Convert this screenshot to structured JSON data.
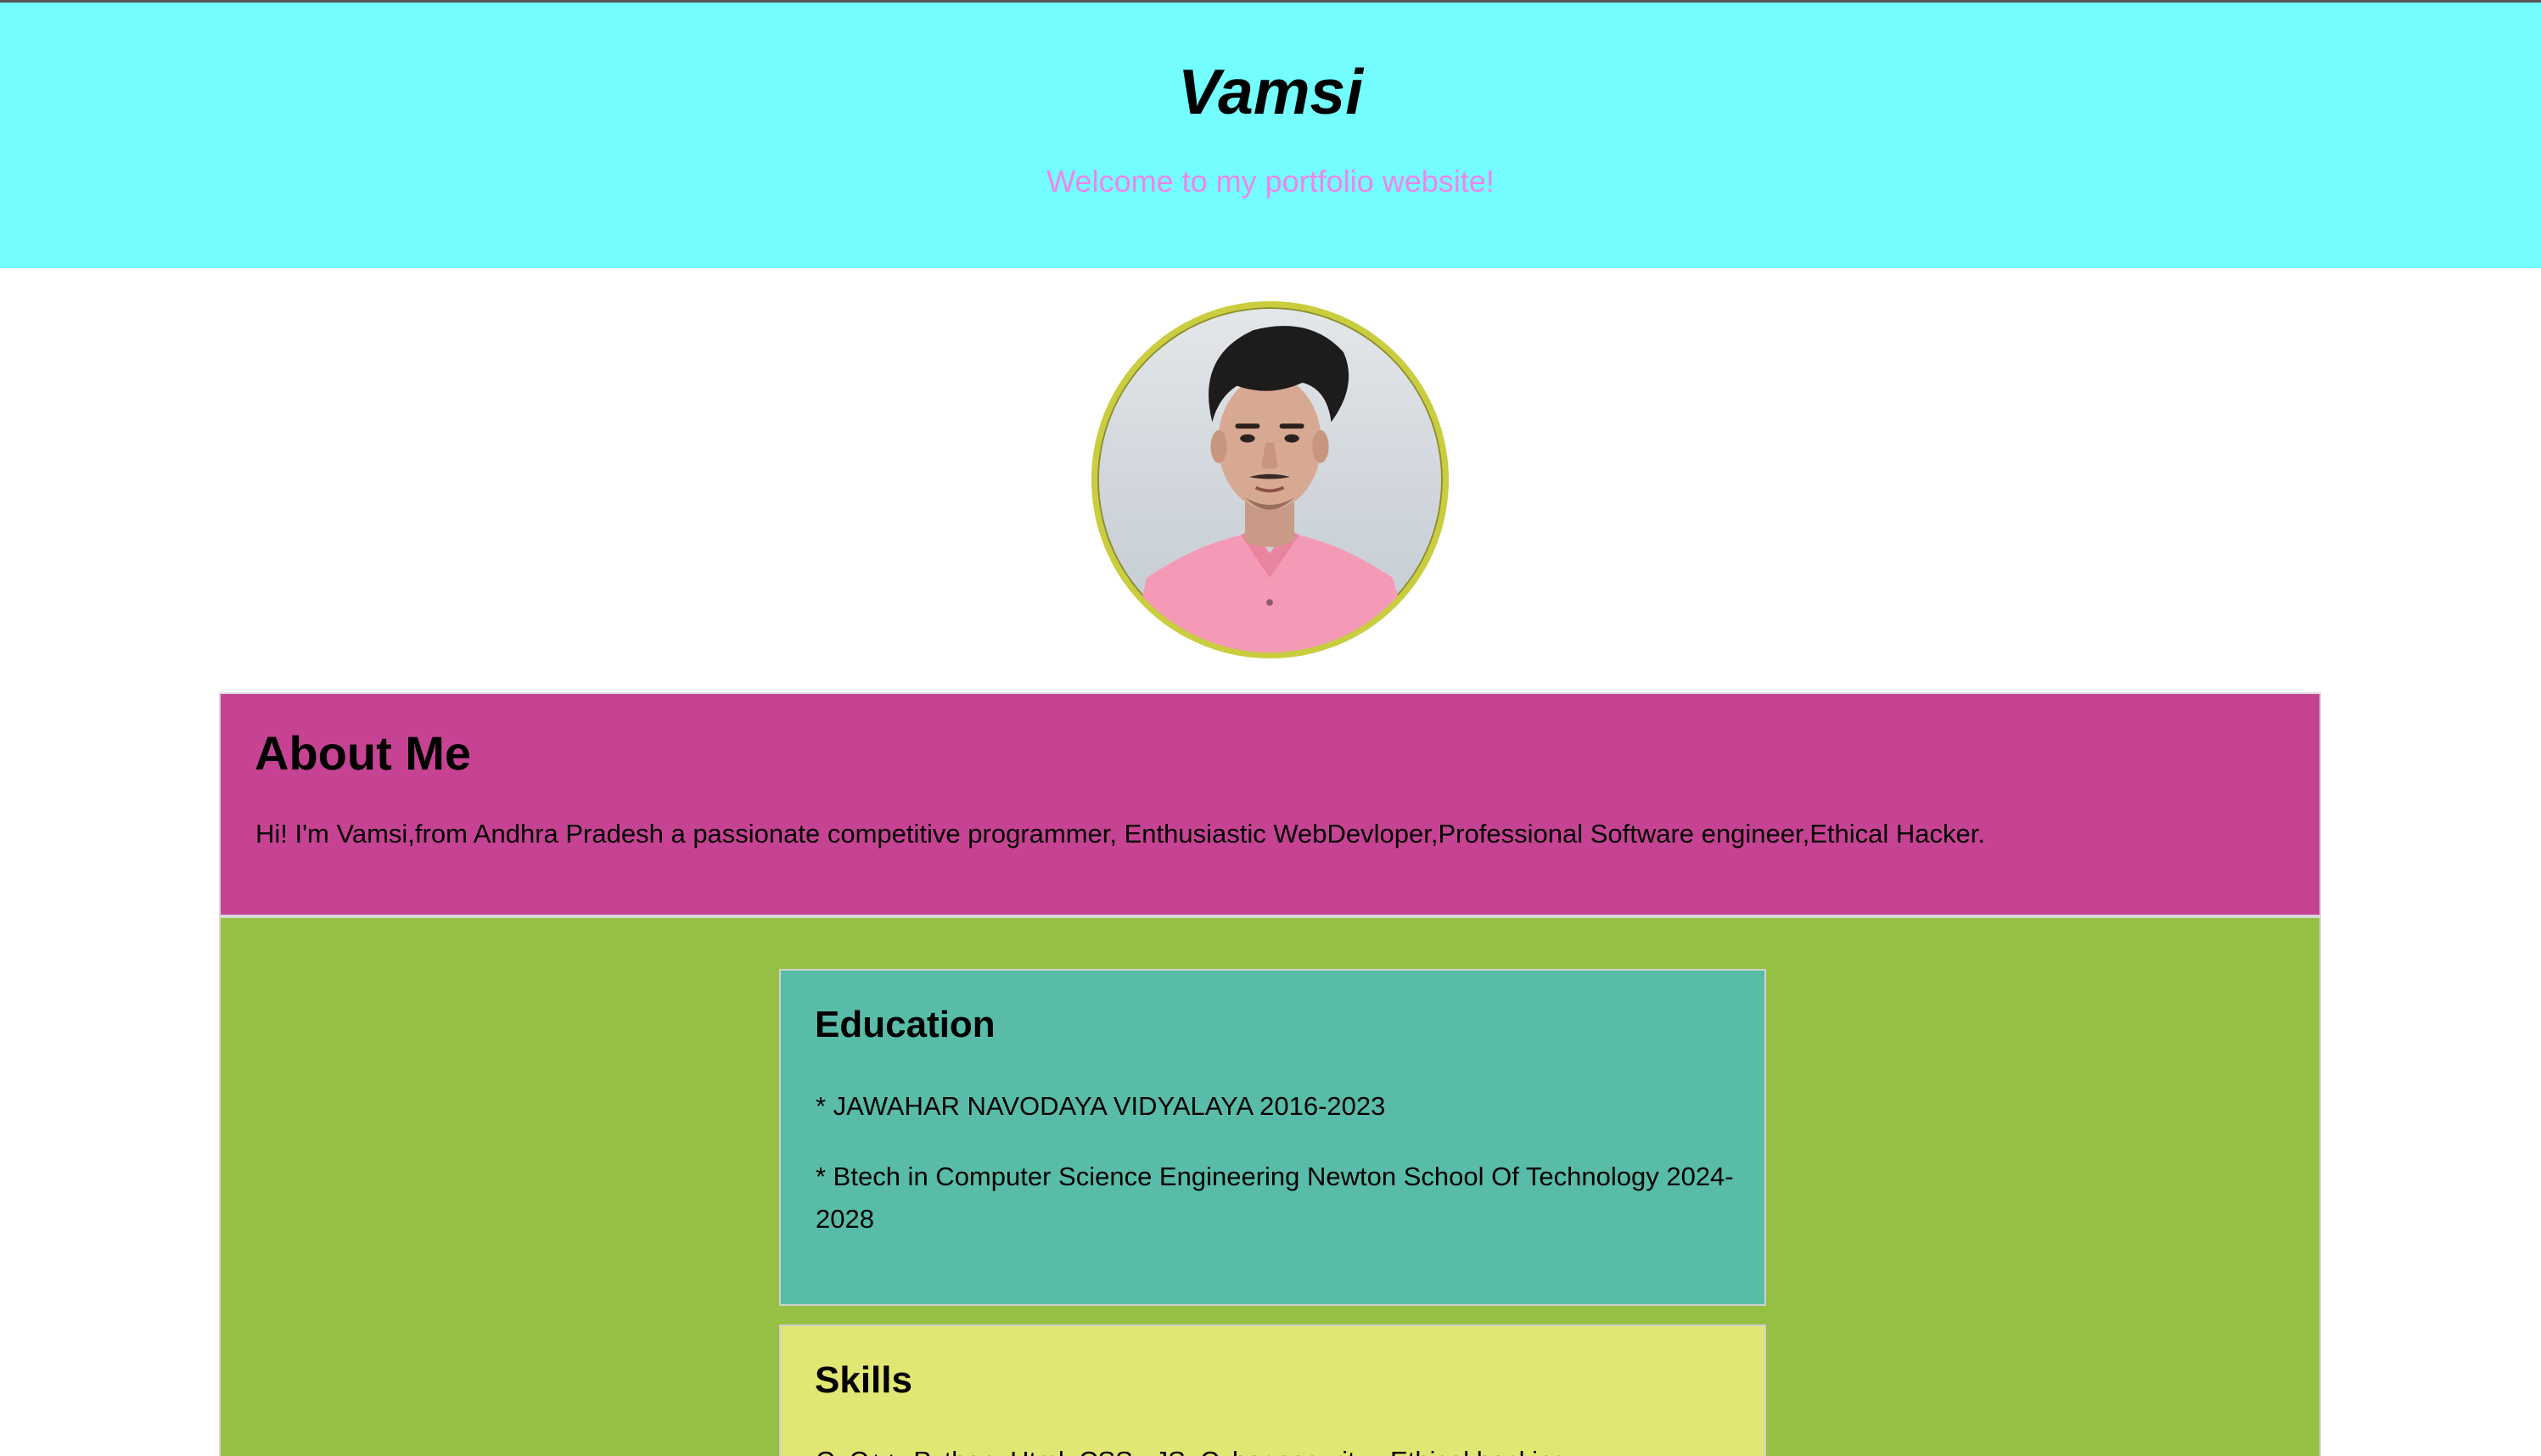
{
  "header": {
    "title": "Vamsi",
    "tagline": "Welcome to my portfolio website!"
  },
  "avatar": {
    "alt": "Profile photo of Vamsi",
    "icon": "profile-photo"
  },
  "about": {
    "heading": "About Me",
    "text": "Hi! I'm Vamsi,from Andhra Pradesh a passionate competitive programmer, Enthusiastic WebDevloper,Professional Software engineer,Ethical Hacker."
  },
  "education": {
    "heading": "Education",
    "items": [
      "* JAWAHAR NAVODAYA VIDYALAYA 2016-2023",
      "* Btech in Computer Science Engineering Newton School Of Technology 2024-2028"
    ]
  },
  "skills": {
    "heading": "Skills",
    "text": "C, C++, Python, Html, CSS , JS, Cyber security , Ethical hacking"
  },
  "colors": {
    "header_bg": "#73fdfe",
    "tagline": "#ed86ea",
    "about_bg": "#c64393",
    "main_bg": "#95c044",
    "education_bg": "#58bca8",
    "skills_bg": "#e2e672",
    "avatar_border": "#c9cd3e"
  }
}
